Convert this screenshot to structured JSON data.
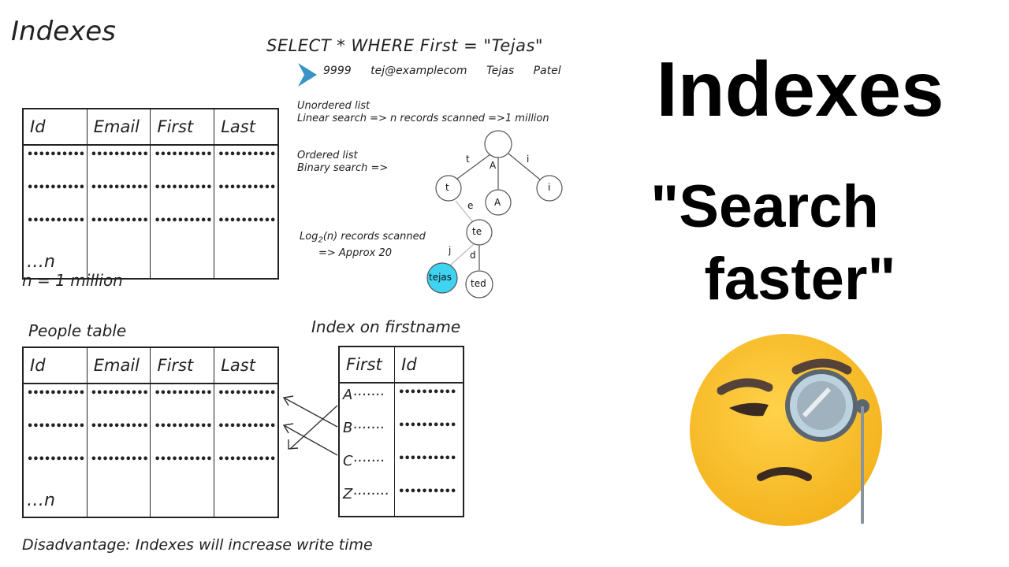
{
  "title": "Indexes",
  "query": "SELECT * WHERE First = \"Tejas\"",
  "result_row": [
    "9999",
    "tej@examplecom",
    "Tejas",
    "Patel"
  ],
  "notes": {
    "unordered_title": "Unordered list",
    "unordered_detail": "Linear search => n records scanned =>1 million",
    "ordered_title": "Ordered list",
    "ordered_detail": "Binary search =>",
    "log_line1": "Log",
    "log_sub": "2",
    "log_rest": "(n) records scanned",
    "log_line2": "=> Approx 20"
  },
  "table_top": {
    "headers": [
      "Id",
      "Email",
      "First",
      "Last"
    ],
    "dots_short": "••••••••••",
    "row_n": "…n",
    "caption": "n = 1 million"
  },
  "table_bottom": {
    "caption": "People table",
    "headers": [
      "Id",
      "Email",
      "First",
      "Last"
    ],
    "row_n": "…n"
  },
  "index_table": {
    "caption": "Index on firstname",
    "headers": [
      "First",
      "Id"
    ],
    "rows": [
      "A·······",
      "B·······",
      "C·······",
      "Z········"
    ]
  },
  "tree": {
    "edges": [
      "t",
      "A",
      "i",
      "e",
      "j",
      "d"
    ],
    "nodes": [
      "t",
      "A",
      "i",
      "te",
      "tejas",
      "ted"
    ],
    "highlight_color": "#3fd3f2"
  },
  "disadvantage": "Disadvantage:  Indexes will increase write time",
  "big_title": "Indexes",
  "tagline_line1": "\"Search",
  "tagline_line2": "faster\"",
  "emoji": "face-with-monocle-emoji"
}
